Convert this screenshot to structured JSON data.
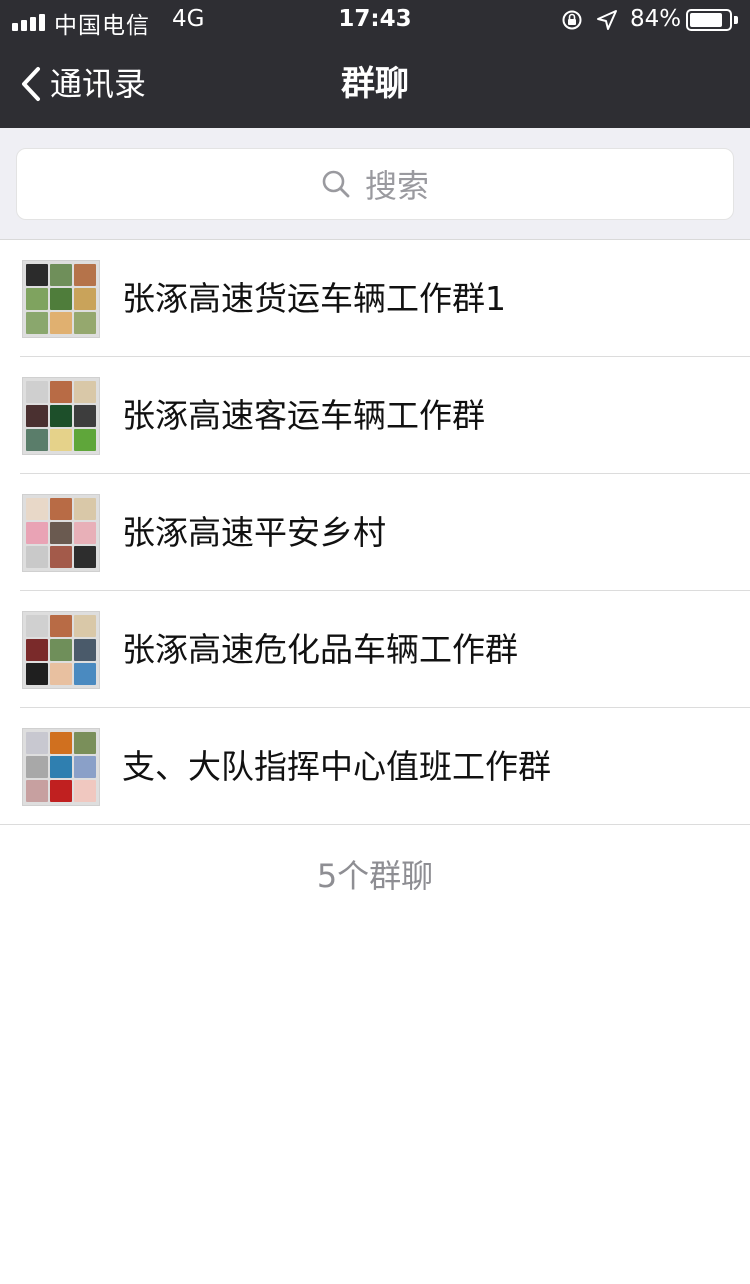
{
  "status_bar": {
    "carrier": "中国电信",
    "network": "4G",
    "time": "17:43",
    "battery": "84%",
    "battery_level": 0.84
  },
  "nav": {
    "back_label": "通讯录",
    "title": "群聊"
  },
  "search": {
    "placeholder": "搜索"
  },
  "groups": [
    {
      "name": "张涿高速货运车辆工作群1",
      "avatar_colors": [
        "#2b2b2b",
        "#6f8f5a",
        "#b5734a",
        "#7fa35f",
        "#4f7d3b",
        "#c9a35a",
        "#8aa76d",
        "#e0b070",
        "#95a86e"
      ]
    },
    {
      "name": "张涿高速客运车辆工作群",
      "avatar_colors": [
        "#cfcfcf",
        "#b86b45",
        "#d9c8a8",
        "#4a3030",
        "#1d4f2a",
        "#3d3d3d",
        "#5a7d6a",
        "#e5d28a",
        "#5fa63a"
      ]
    },
    {
      "name": "张涿高速平安乡村",
      "avatar_colors": [
        "#e8d8c8",
        "#b86b45",
        "#d9c8a8",
        "#e9a3b5",
        "#6a5a50",
        "#e8b0b8",
        "#c9c9c9",
        "#a35a4a",
        "#2d2d2d"
      ]
    },
    {
      "name": "张涿高速危化品车辆工作群",
      "avatar_colors": [
        "#d0d0d0",
        "#b86b45",
        "#d9c8a8",
        "#7a2a2a",
        "#6f8f5a",
        "#4a5a6a",
        "#1f1f1f",
        "#e8c0a0",
        "#4a8ac0"
      ]
    },
    {
      "name": "支、大队指挥中心值班工作群",
      "avatar_colors": [
        "#c8c8d0",
        "#d0701f",
        "#7a8f5a",
        "#a8a8a8",
        "#2f7fb0",
        "#8aa0c8",
        "#c7a0a0",
        "#c02020",
        "#f0c8c0"
      ]
    }
  ],
  "footer": {
    "count_label": "5个群聊"
  },
  "colors": {
    "nav_bg": "#2e2e33",
    "search_bg": "#efeff4",
    "footer_text": "#8e8e93"
  }
}
